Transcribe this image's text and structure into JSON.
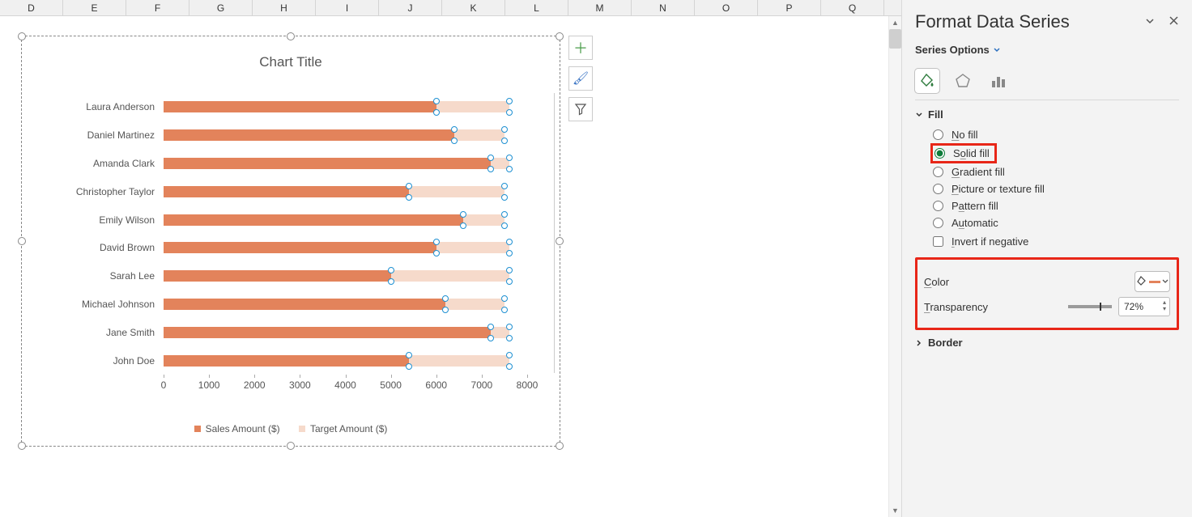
{
  "columns": [
    "D",
    "E",
    "F",
    "G",
    "H",
    "I",
    "J",
    "K",
    "L",
    "M",
    "N",
    "O",
    "P",
    "Q"
  ],
  "chart": {
    "title": "Chart Title",
    "xticks": [
      "0",
      "1000",
      "2000",
      "3000",
      "4000",
      "5000",
      "6000",
      "7000",
      "8000"
    ],
    "xmax": 8000,
    "categories": [
      "Laura Anderson",
      "Daniel Martinez",
      "Amanda Clark",
      "Christopher Taylor",
      "Emily Wilson",
      "David Brown",
      "Sarah Lee",
      "Michael Johnson",
      "Jane Smith",
      "John Doe"
    ],
    "legend": {
      "s1": "Sales Amount ($)",
      "s2": "Target Amount ($)"
    }
  },
  "chart_data": {
    "type": "bar",
    "orientation": "horizontal",
    "stacked": true,
    "title": "Chart Title",
    "xlabel": "",
    "ylabel": "",
    "xlim": [
      0,
      8000
    ],
    "categories": [
      "Laura Anderson",
      "Daniel Martinez",
      "Amanda Clark",
      "Christopher Taylor",
      "Emily Wilson",
      "David Brown",
      "Sarah Lee",
      "Michael Johnson",
      "Jane Smith",
      "John Doe"
    ],
    "series": [
      {
        "name": "Sales Amount ($)",
        "color": "#E3835B",
        "values": [
          6000,
          6400,
          7200,
          5400,
          6600,
          6000,
          5000,
          6200,
          7200,
          5400
        ]
      },
      {
        "name": "Target Amount ($)",
        "color": "#F6DACB",
        "values": [
          7600,
          7500,
          7600,
          7500,
          7500,
          7600,
          7600,
          7500,
          7600,
          7600
        ]
      }
    ]
  },
  "tools": {
    "plus": "＋",
    "brush": "✎",
    "filter": "▽"
  },
  "panel": {
    "title": "Format Data Series",
    "series_options": "Series Options",
    "fill": "Fill",
    "radios": {
      "no_fill": "No fill",
      "solid_fill": "Solid fill",
      "gradient_fill": "Gradient fill",
      "picture_fill": "Picture or texture fill",
      "pattern_fill": "Pattern fill",
      "automatic": "Automatic"
    },
    "invert": "Invert if negative",
    "color_label": "Color",
    "transparency_label": "Transparency",
    "transparency_value": "72%",
    "border": "Border"
  }
}
